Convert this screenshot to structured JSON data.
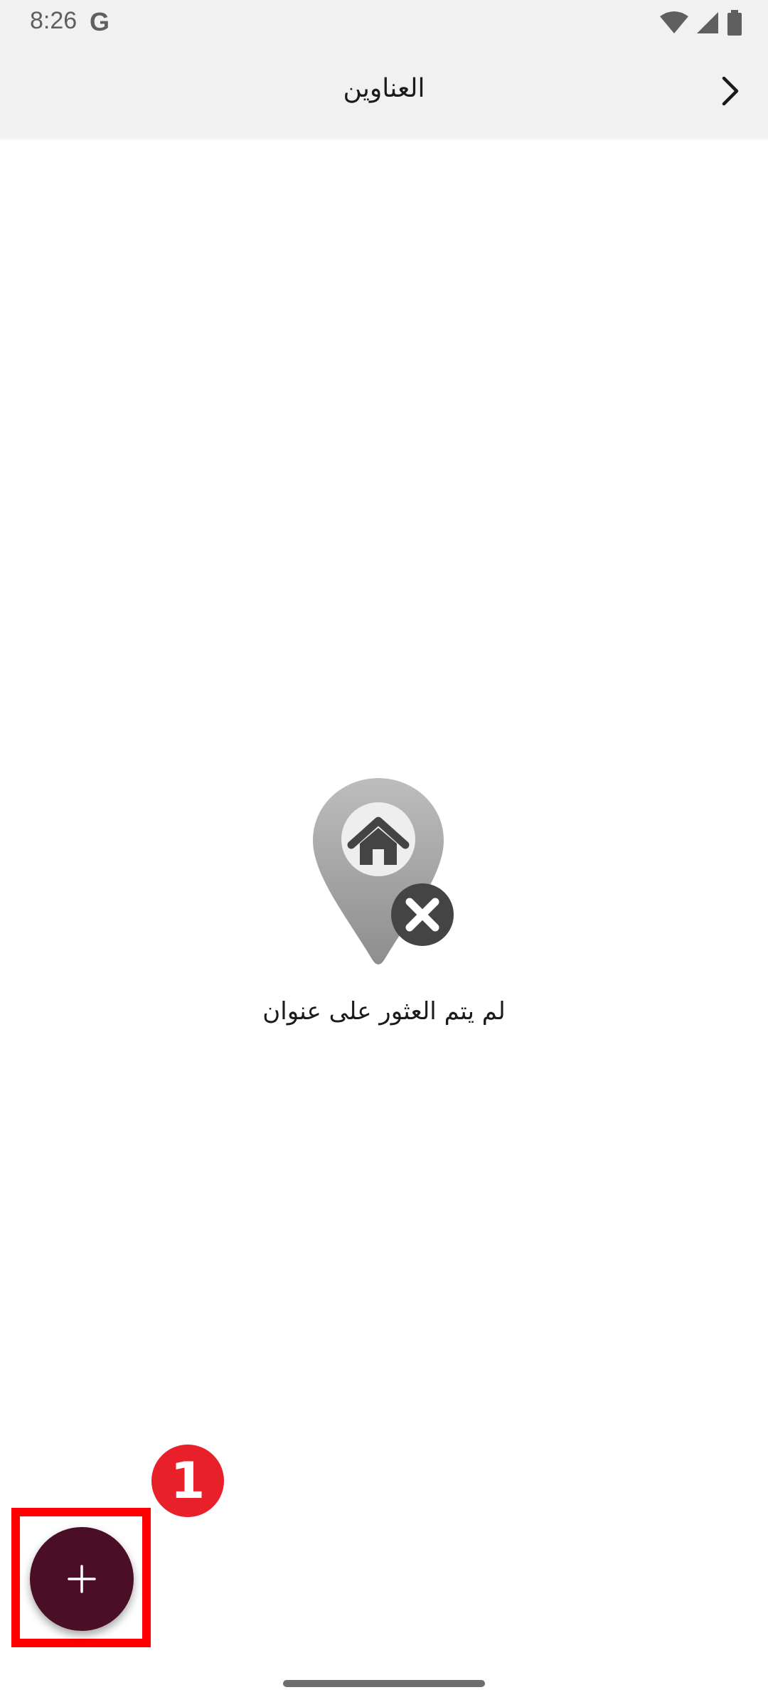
{
  "status_bar": {
    "time": "8:26",
    "google_glyph": "G"
  },
  "app_bar": {
    "title": "العناوين",
    "back_icon": "chevron-right-icon"
  },
  "empty_state": {
    "message": "لم يتم العثور على عنوان",
    "illustration_icon": "location-pin-home-x-icon"
  },
  "fab": {
    "label": "+",
    "icon": "plus-icon"
  },
  "annotation": {
    "badge_number": "1"
  },
  "colors": {
    "fab_background": "#4a0f26",
    "highlight": "#ff0000",
    "badge": "#e8202a",
    "bar_background": "#f2f1f2"
  }
}
